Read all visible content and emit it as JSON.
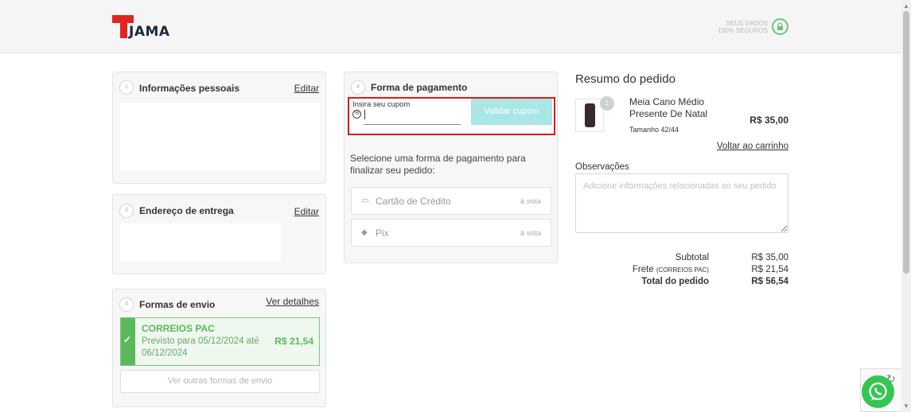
{
  "header": {
    "logo_text": "JAMA",
    "secure_text": "SEUS DADOS 100% SEGUROS",
    "icon": "lock-icon"
  },
  "personal": {
    "step": "1",
    "title": "Informações pessoais",
    "edit_label": "Editar"
  },
  "delivery": {
    "step": "2",
    "title": "Endereço de entrega",
    "edit_label": "Editar"
  },
  "shipping": {
    "step": "3",
    "title": "Formas de envio",
    "details_label": "Ver detalhes",
    "selected": {
      "name": "CORREIOS PAC",
      "eta": "Previsto para 05/12/2024 até 06/12/2024",
      "price": "R$ 21,54"
    },
    "other_label": "Ver outras formas de envio"
  },
  "payment": {
    "step": "4",
    "title": "Forma de pagamento",
    "coupon_label": "Insira seu cupom",
    "coupon_value": "",
    "validate_label": "Validar cupom",
    "intro": "Selecione uma forma de pagamento para finalizar seu pedido:",
    "options": [
      {
        "label": "Cartão de Crédito",
        "note": "à vista",
        "icon": "credit-card-icon"
      },
      {
        "label": "Pix",
        "note": "à vista",
        "icon": "pix-icon"
      }
    ]
  },
  "summary": {
    "title": "Resumo do pedido",
    "product": {
      "name": "Meia Cano Médio Presente De Natal",
      "size": "Tamanho 42/44",
      "price": "R$ 35,00",
      "qty": "1"
    },
    "back_label": "Voltar ao carrinho",
    "notes_label": "Observações",
    "notes_placeholder": "Adicione informações relacionadas ao seu pedido",
    "subtotal_label": "Subtotal",
    "subtotal_value": "R$ 35,00",
    "shipping_label": "Frete",
    "shipping_method": "(CORREIOS PAC)",
    "shipping_value": "R$ 21,54",
    "total_label": "Total do pedido",
    "total_value": "R$ 56,54"
  },
  "colors": {
    "brand_red": "#e0261f",
    "success_green": "#5cb85c",
    "validate_button": "#a9e6e6",
    "highlight_border": "#e01818",
    "whatsapp": "#35c553"
  }
}
